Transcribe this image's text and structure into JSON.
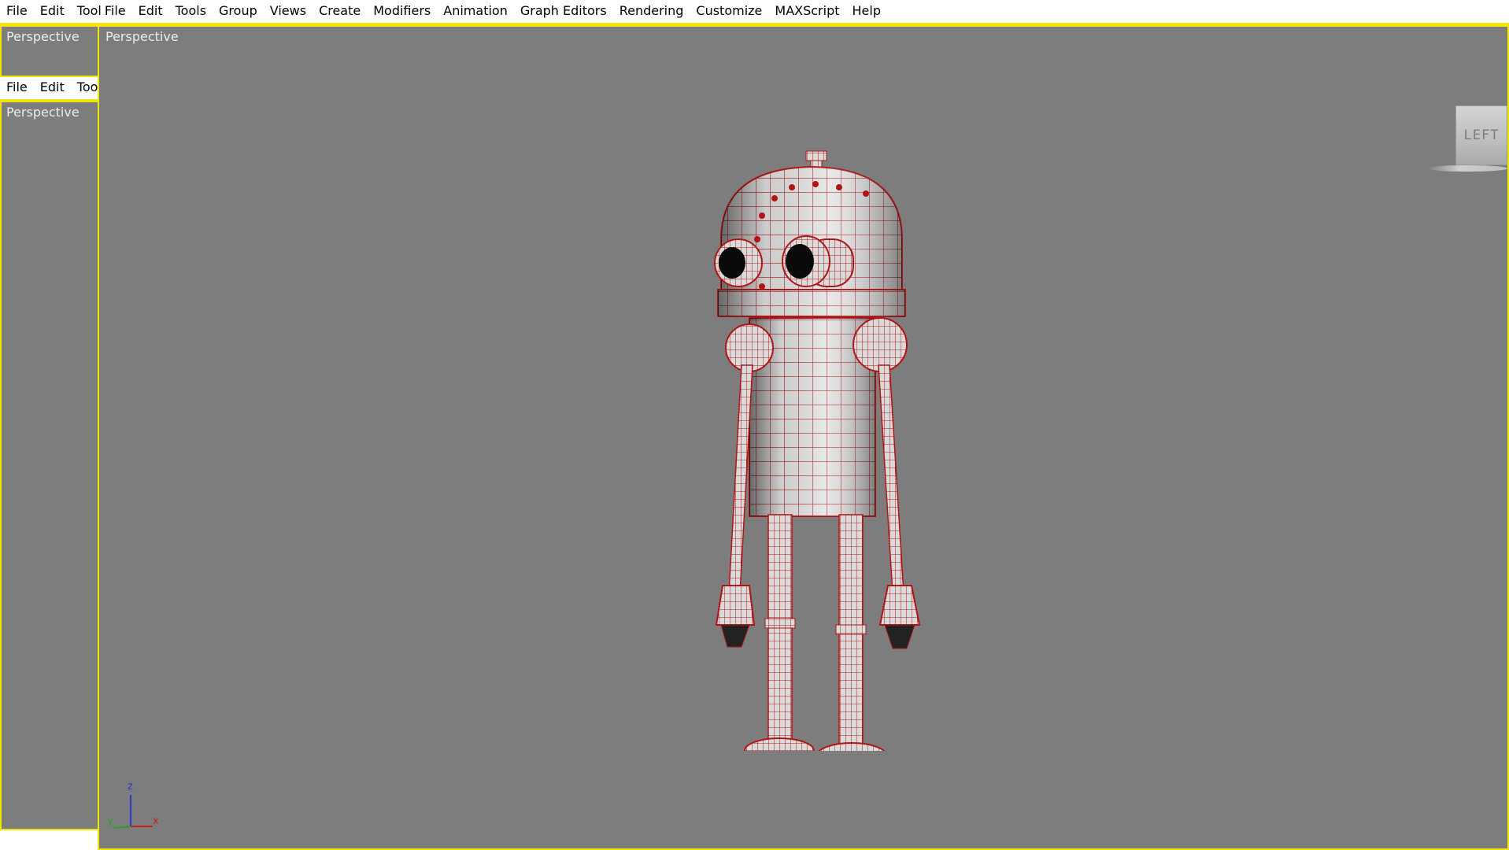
{
  "main_menu": {
    "items": [
      "File",
      "Edit",
      "Tool",
      "File",
      "Edit",
      "Tools",
      "Group",
      "Views",
      "Create",
      "Modifiers",
      "Animation",
      "Graph Editors",
      "Rendering",
      "Customize",
      "MAXScript",
      "Help"
    ]
  },
  "left_panel": {
    "top_viewport_label": "Perspective",
    "menu": [
      "File",
      "Edit",
      "Tool"
    ],
    "bottom_viewport_label": "Perspective"
  },
  "main_viewport": {
    "label": "Perspective",
    "viewcube_face": "LEFT",
    "axis": {
      "z": "z",
      "y": "y",
      "x": "x"
    }
  },
  "colors": {
    "accent_border": "#f2e600",
    "viewport_bg": "#7d7d7d",
    "wireframe": "#b01515"
  },
  "icons": [
    "viewcube-icon",
    "axis-tripod-icon"
  ]
}
